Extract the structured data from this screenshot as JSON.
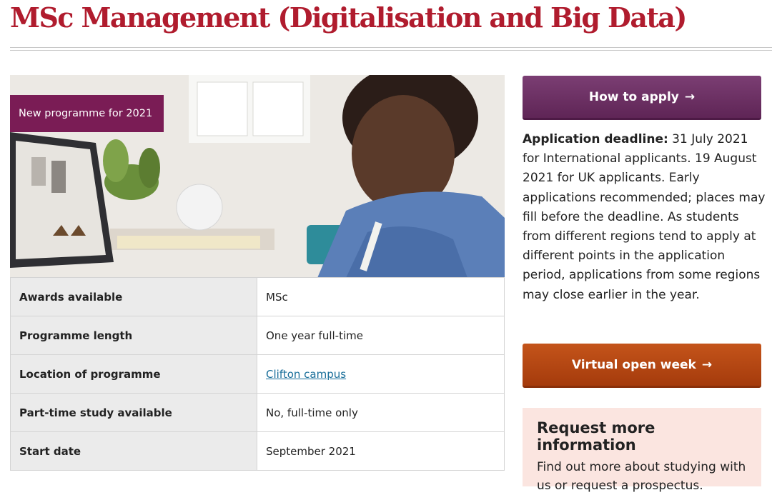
{
  "page": {
    "title": "MSc Management (Digitalisation and Big Data)"
  },
  "hero": {
    "badge": "New programme for 2021"
  },
  "info_table": [
    {
      "label": "Awards available",
      "value": "MSc"
    },
    {
      "label": "Programme length",
      "value": "One year full-time"
    },
    {
      "label": "Location of programme",
      "value": "Clifton campus"
    },
    {
      "label": "Part-time study available",
      "value": "No, full-time only"
    },
    {
      "label": "Start date",
      "value": "September 2021"
    }
  ],
  "sidebar": {
    "apply_button": "How to apply",
    "deadline_label": "Application deadline:",
    "deadline_text": " 31 July 2021 for International applicants. 19 August 2021 for UK applicants. Early applications recommended; places may fill before the deadline. As students from different regions tend to apply at different points in the application period, applications from some regions may close earlier in the year.",
    "open_week_button": "Virtual open week",
    "request_heading": "Request more information",
    "request_text": "Find out more about studying with us or request a prospectus."
  },
  "colors": {
    "title": "#b01c2e",
    "badge": "#7a1c55",
    "apply_button": "#6b2d62",
    "open_week_button": "#b5470f",
    "request_box": "#fbe5e0",
    "link": "#1a6f9a"
  },
  "icons": [
    "arrow-right-icon"
  ]
}
